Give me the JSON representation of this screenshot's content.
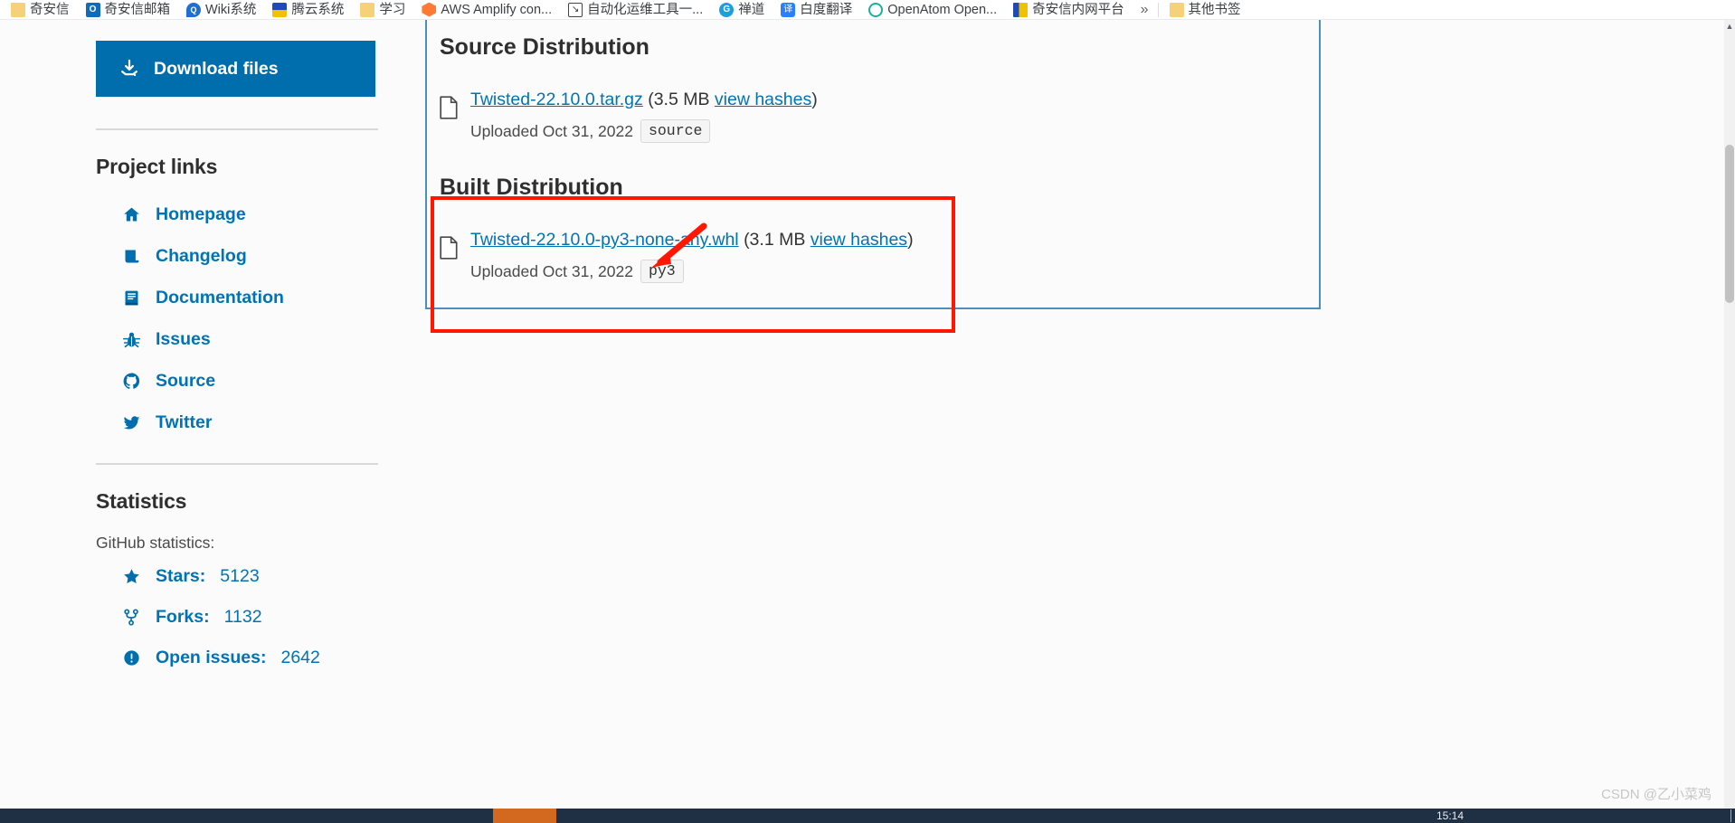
{
  "browser": {
    "bookmarks": [
      {
        "label": "奇安信",
        "icon": "folder-icon",
        "icon_class": "ico-folder"
      },
      {
        "label": "奇安信邮箱",
        "icon": "outlook-icon",
        "icon_class": "ico-outlook"
      },
      {
        "label": "Wiki系统",
        "icon": "wiki-icon",
        "icon_class": "ico-wiki"
      },
      {
        "label": "腾云系统",
        "icon": "tengyun-icon",
        "icon_class": "ico-tengyun"
      },
      {
        "label": "学习",
        "icon": "folder-icon",
        "icon_class": "ico-folder"
      },
      {
        "label": "AWS Amplify con...",
        "icon": "aws-amplify-icon",
        "icon_class": "ico-aws"
      },
      {
        "label": "自动化运维工具一...",
        "icon": "automation-icon",
        "icon_class": "ico-auto"
      },
      {
        "label": "禅道",
        "icon": "zentao-icon",
        "icon_class": "ico-chandao"
      },
      {
        "label": "白度翻译",
        "icon": "translate-icon",
        "icon_class": "ico-fanyi"
      },
      {
        "label": "OpenAtom Open...",
        "icon": "openatom-icon",
        "icon_class": "ico-openatom"
      },
      {
        "label": "奇安信内网平台",
        "icon": "intranet-icon",
        "icon_class": "ico-neiwang"
      }
    ],
    "overflow_label": "»",
    "other_bookmarks": {
      "label": "其他书签",
      "icon": "folder-icon",
      "icon_class": "ico-folder"
    }
  },
  "sidebar": {
    "download_button": {
      "label": "Download files",
      "icon": "download-icon",
      "bg_color": "#006dad"
    },
    "project_links": {
      "title": "Project links",
      "items": [
        {
          "label": "Homepage",
          "icon": "home-icon"
        },
        {
          "label": "Changelog",
          "icon": "changelog-icon"
        },
        {
          "label": "Documentation",
          "icon": "book-icon"
        },
        {
          "label": "Issues",
          "icon": "bug-icon"
        },
        {
          "label": "Source",
          "icon": "github-icon"
        },
        {
          "label": "Twitter",
          "icon": "twitter-icon"
        }
      ]
    },
    "statistics": {
      "title": "Statistics",
      "caption": "GitHub statistics:",
      "items": [
        {
          "label": "Stars:",
          "value": "5123",
          "icon": "star-icon"
        },
        {
          "label": "Forks:",
          "value": "1132",
          "icon": "fork-icon"
        },
        {
          "label": "Open issues:",
          "value": "2642",
          "icon": "issue-icon"
        }
      ]
    }
  },
  "main": {
    "source_distribution": {
      "title": "Source Distribution",
      "file_name": "Twisted-22.10.0.tar.gz",
      "size_open": "(3.5 MB ",
      "view_hashes": "view hashes",
      "size_close": ")",
      "uploaded": "Uploaded Oct 31, 2022",
      "badge": "source",
      "file_icon": "file-icon"
    },
    "built_distribution": {
      "title": "Built Distribution",
      "file_name": "Twisted-22.10.0-py3-none-any.whl",
      "size_open": "(3.1 MB ",
      "view_hashes": "view hashes",
      "size_close": ")",
      "uploaded": "Uploaded Oct 31, 2022",
      "badge": "py3",
      "file_icon": "file-icon"
    }
  },
  "annotations": {
    "highlight_box_color": "#ff1700",
    "arrow_color": "#ff1700",
    "arrow_name": "red-pointer-arrow"
  },
  "watermark": "CSDN @乙小菜鸡",
  "taskbar": {
    "clock": "15:14"
  }
}
